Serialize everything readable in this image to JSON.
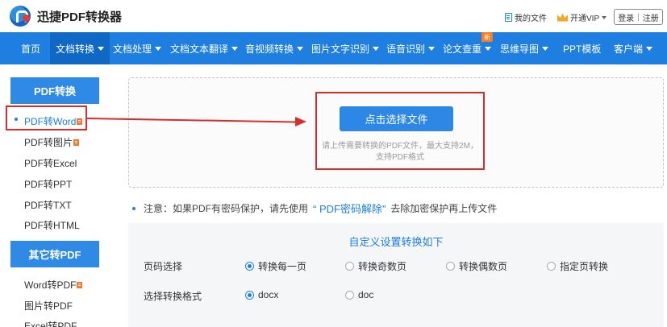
{
  "header": {
    "brand": "迅捷PDF转换器",
    "my_docs": "我的文件",
    "vip": "开通VIP",
    "login": "登录",
    "login_sep": "|",
    "register": "注册"
  },
  "nav": {
    "items": [
      {
        "label": "首页"
      },
      {
        "label": "文档转换"
      },
      {
        "label": "文档处理"
      },
      {
        "label": "文档文本翻译"
      },
      {
        "label": "音视频转换"
      },
      {
        "label": "图片文字识别"
      },
      {
        "label": "语音识别"
      },
      {
        "label": "论文查重"
      },
      {
        "label": "思维导图"
      },
      {
        "label": "PPT模板"
      },
      {
        "label": "客户端"
      }
    ],
    "badge": "新"
  },
  "sidebar": {
    "group1_title": "PDF转换",
    "group1_items": [
      "PDF转Word",
      "PDF转图片",
      "PDF转Excel",
      "PDF转PPT",
      "PDF转TXT",
      "PDF转HTML"
    ],
    "group2_title": "其它转PDF",
    "group2_items": [
      "Word转PDF",
      "图片转PDF",
      "Excel转PDF"
    ]
  },
  "upload": {
    "button": "点击选择文件",
    "hint_line1": "请上传需要转换的PDF文件，最大支持2M，",
    "hint_line2": "支持PDF格式"
  },
  "notice": {
    "prefix": "注意：如果PDF有密码保护，请先使用",
    "link": "“ PDF密码解除”",
    "suffix": "去除加密保护再上传文件"
  },
  "settings": {
    "title": "自定义设置转换如下",
    "page_label": "页码选择",
    "page_options": [
      "转换每一页",
      "转换奇数页",
      "转换偶数页",
      "指定页转换"
    ],
    "page_selected": "转换每一页",
    "format_label": "选择转换格式",
    "format_options": [
      "docx",
      "doc"
    ],
    "format_selected": "docx"
  },
  "colors": {
    "accent": "#1e7fe0",
    "nav_active": "#0e68c4",
    "highlight_red": "#d92c2c",
    "tag_orange": "#f07a29"
  }
}
